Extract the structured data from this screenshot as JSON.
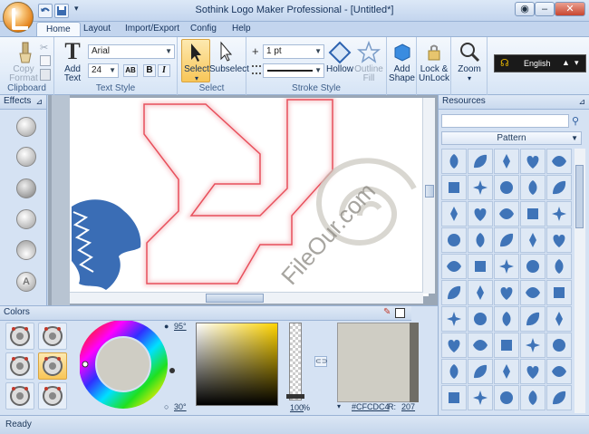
{
  "window": {
    "title": "Sothink Logo Maker Professional - [Untitled*]",
    "controls": [
      "minimize",
      "maximize",
      "close"
    ]
  },
  "ribbon_tabs": [
    {
      "label": "Home",
      "active": true
    },
    {
      "label": "Layout",
      "active": false
    },
    {
      "label": "Import/Export",
      "active": false
    },
    {
      "label": "Config",
      "active": false
    },
    {
      "label": "Help",
      "active": false
    }
  ],
  "clipboard": {
    "group_label": "Clipboard",
    "copy_format": "Copy\nFormat"
  },
  "text_style": {
    "group_label": "Text Style",
    "add_text": "Add\nText",
    "font_name": "Arial",
    "font_size": "24"
  },
  "select_group": {
    "group_label": "Select",
    "select": "Select",
    "subselect": "Subselect"
  },
  "stroke_style": {
    "group_label": "Stroke Style",
    "width": "1 pt",
    "hollow": "Hollow",
    "outline_fill": "Outline\nFill"
  },
  "add_shape": "Add\nShape",
  "lock_unlock": "Lock &\nUnLock",
  "zoom": "Zoom",
  "language": "English",
  "effects_panel": {
    "title": "Effects"
  },
  "canvas": {
    "watermark": "FileOur.com"
  },
  "resources_panel": {
    "title": "Resources",
    "category": "Pattern",
    "search_value": ""
  },
  "colors_panel": {
    "title": "Colors",
    "brightness": "95°",
    "angle": "30°",
    "opacity": "100",
    "opacity_unit": "%",
    "hex": "#CFCDC4",
    "r_label": "R:",
    "r_value": "207"
  },
  "status": {
    "text": "Ready"
  },
  "colors": {
    "ribbon_bg": "#e3edf9",
    "accent_select": "#f8c658",
    "red_shape": "#e8505c",
    "lion_blue": "#3a6db5",
    "resource_blue": "#3f74b8"
  }
}
